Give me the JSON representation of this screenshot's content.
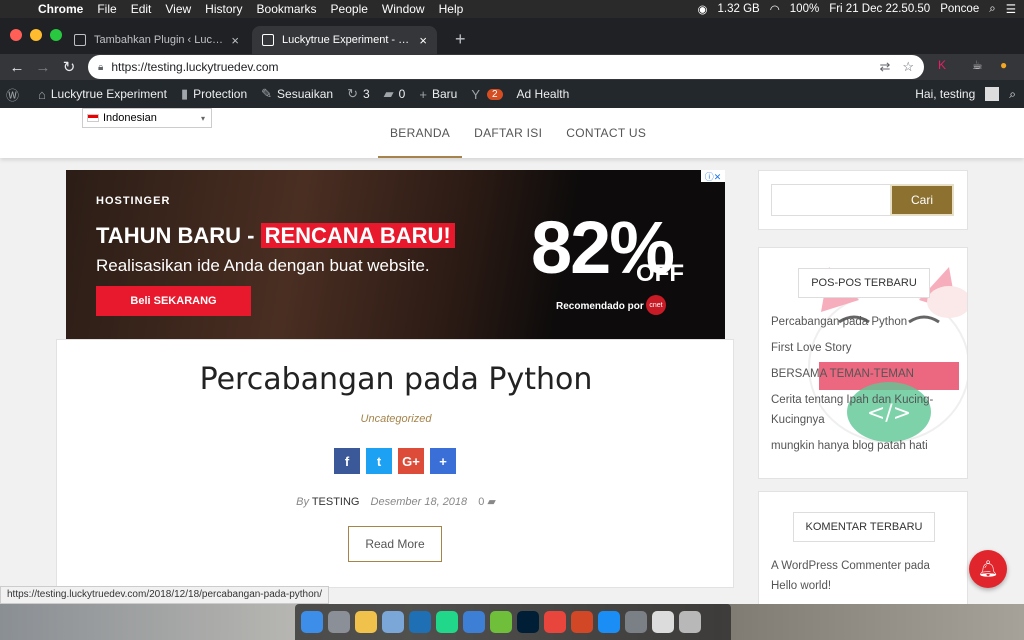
{
  "menubar": {
    "items": [
      "Chrome",
      "File",
      "Edit",
      "View",
      "History",
      "Bookmarks",
      "People",
      "Window",
      "Help"
    ],
    "memory": "1.32 GB",
    "battery": "100%",
    "clock": "Fri 21 Dec  22.50.50",
    "user": "Poncoe"
  },
  "tabs": [
    {
      "title": "Tambahkan Plugin ‹ Luckytrue",
      "active": false
    },
    {
      "title": "Luckytrue Experiment - Hello W",
      "active": true
    }
  ],
  "address": {
    "url": "https://testing.luckytruedev.com"
  },
  "wpbar": {
    "site": "Luckytrue Experiment",
    "protection": "Protection",
    "customize": "Sesuaikan",
    "updates": "3",
    "comments": "0",
    "new": "Baru",
    "yoast_count": "2",
    "adhealth": "Ad Health",
    "greeting": "Hai, testing"
  },
  "site": {
    "language": "Indonesian",
    "nav": [
      "BERANDA",
      "DAFTAR ISI",
      "CONTACT US"
    ]
  },
  "ad": {
    "brand": "HOSTINGER",
    "headline_a": "TAHUN BARU - ",
    "headline_b": "RENCANA BARU!",
    "sub": "Realisasikan ide Anda dengan buat website.",
    "cta": "Beli SEKARANG",
    "percent": "82%",
    "off": "OFF",
    "recommended": "Recomendado por",
    "cnet": "cnet"
  },
  "article": {
    "title": "Percabangan pada Python",
    "category": "Uncategorized",
    "by": "By",
    "author": "TESTING",
    "date": "Desember 18, 2018",
    "comments": "0",
    "read_more": "Read More"
  },
  "share": [
    {
      "icon": "facebook-icon",
      "glyph": "f",
      "color": "#3b5998"
    },
    {
      "icon": "twitter-icon",
      "glyph": "t",
      "color": "#1da1f2"
    },
    {
      "icon": "google-plus-icon",
      "glyph": "G+",
      "color": "#dd4b39"
    },
    {
      "icon": "share-plus-icon",
      "glyph": "+",
      "color": "#3a6fd8"
    }
  ],
  "sidebar": {
    "search_button": "Cari",
    "recent_posts_title": "POS-POS TERBARU",
    "recent_posts": [
      "Percabangan pada Python",
      "First Love Story",
      "BERSAMA TEMAN-TEMAN",
      "Cerita tentang Ipah dan Kucing-Kucingnya",
      "mungkin hanya blog patah hati"
    ],
    "recent_comments_title": "KOMENTAR TERBARU",
    "comment": "A WordPress Commenter pada Hello world!"
  },
  "status_url": "https://testing.luckytruedev.com/2018/12/18/percabangan-pada-python/",
  "colors": {
    "accent": "#a5834a",
    "wp_bar": "#23282d",
    "ad_red": "#e8192c"
  }
}
